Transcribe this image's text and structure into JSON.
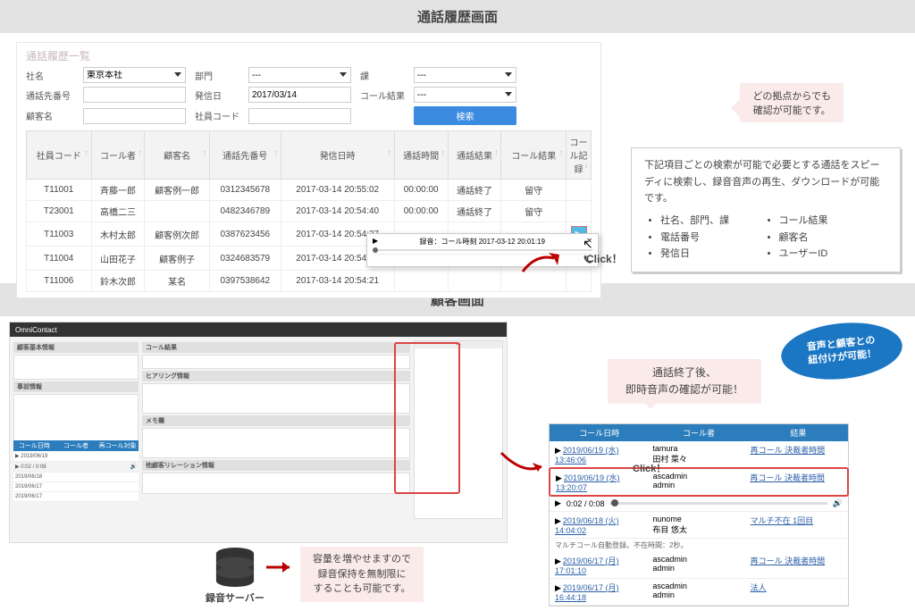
{
  "section1": {
    "title": "通話履歴画面",
    "panel_title": "通話履歴一覧",
    "filters": {
      "company_label": "社名",
      "company_value": "東京本社",
      "dept_label": "部門",
      "dept_value": "---",
      "section_label": "課",
      "section_value": "---",
      "phone_label": "通話先番号",
      "date_label": "発信日",
      "date_value": "2017/03/14",
      "result_label": "コール結果",
      "result_value": "---",
      "customer_label": "顧客名",
      "emp_label": "社員コード",
      "search": "検索"
    },
    "columns": [
      "社員コード",
      "コール者",
      "顧客名",
      "通話先番号",
      "発信日時",
      "通話時間",
      "通話結果",
      "コール結果",
      "コール記録"
    ],
    "rows": [
      {
        "c": [
          "T11001",
          "斉藤一郎",
          "顧客例一郎",
          "0312345678",
          "2017-03-14 20:55:02",
          "00:00:00",
          "通話終了",
          "留守",
          ""
        ]
      },
      {
        "c": [
          "T23001",
          "高橋二三",
          "",
          "0482346789",
          "2017-03-14 20:54:40",
          "00:00:00",
          "通話終了",
          "留守",
          ""
        ]
      },
      {
        "c": [
          "T11003",
          "木村太郎",
          "顧客例次郎",
          "0387623456",
          "2017-03-14 20:54:37",
          "",
          "",
          "",
          "▶"
        ]
      },
      {
        "c": [
          "T11004",
          "山田花子",
          "顧客例子",
          "0324683579",
          "2017-03-14 20:54:24",
          "",
          "",
          "",
          "▶"
        ]
      },
      {
        "c": [
          "T11006",
          "鈴木次郎",
          "某名",
          "0397538642",
          "2017-03-14 20:54:21",
          "",
          "",
          "",
          ""
        ]
      }
    ],
    "audio_header": "録音：コール時刻 2017-03-12 20:01:19",
    "callout": "どの拠点からでも\n確認が可能です。",
    "info_text": "下記項目ごとの検索が可能で必要とする通話をスピーディに検索し、録音音声の再生、ダウンロードが可能です。",
    "info_items": [
      "社名、部門、課",
      "電話番号",
      "発信日",
      "コール結果",
      "顧客名",
      "ユーザーID"
    ],
    "click": "Click！"
  },
  "section2": {
    "title": "顧客画面",
    "brand": "OmniContact",
    "panel_labels": {
      "basic": "顧客基本情報",
      "call": "コール結果",
      "hearing": "ヒアリング情報",
      "memo": "メモ欄",
      "rel": "他顧客リレーション情報",
      "case": "事前情報"
    },
    "mini_tabs": [
      "コール日時",
      "コール者",
      "再コール対象"
    ],
    "callout_top": "通話終了後、\n即時音声の確認が可能！",
    "oval": "音声と顧客との\n紐付けが可能！",
    "server_label": "録音サーバー",
    "callout_server": "容量を増やせますので\n録音保持を無制限に\nすることも可能です。",
    "detail_head": [
      "コール日時",
      "コール者",
      "結果"
    ],
    "detail_rows": [
      {
        "dt": "2019/06/19 (水)",
        "tm": "13:46:06",
        "who": "tamura\n田村 菜々",
        "res": "再コール 決裁者時間"
      },
      {
        "dt": "2019/06/19 (水)",
        "tm": "13:20:07",
        "who": "ascadmin\nadmin",
        "res": "再コール 決裁者時間",
        "hl": true
      },
      {
        "audio": "0:02 / 0:08"
      },
      {
        "dt": "2019/06/18 (火)",
        "tm": "14:04:02",
        "who": "nunome\n布目 悠太",
        "res": "マルチ不在 1回目",
        "note": "マルチコール自動登録。不在時間：2秒。"
      },
      {
        "dt": "2019/06/17 (月)",
        "tm": "17:01:10",
        "who": "ascadmin\nadmin",
        "res": "再コール 決裁者時間"
      },
      {
        "dt": "2019/06/17 (月)",
        "tm": "16:44:18",
        "who": "ascadmin\nadmin",
        "res": "法人"
      }
    ],
    "click": "Click！"
  }
}
